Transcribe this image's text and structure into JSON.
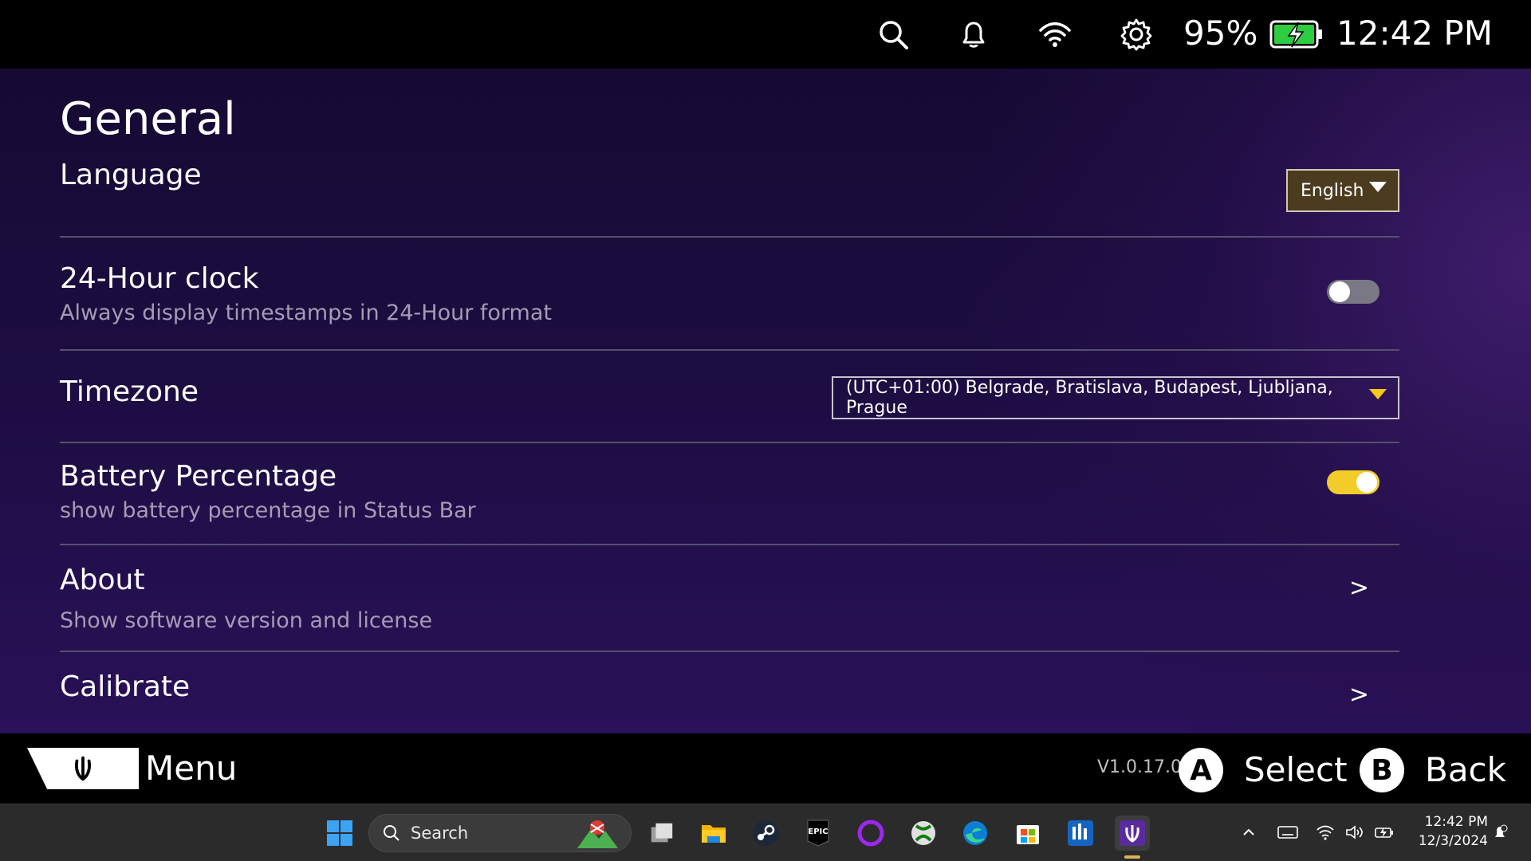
{
  "status_bar": {
    "icons": [
      "search-icon",
      "bell-icon",
      "wifi-icon",
      "gear-icon"
    ],
    "battery_percent": "95%",
    "battery_icon": "battery-charging-icon",
    "time": "12:42 PM"
  },
  "page": {
    "title": "General"
  },
  "settings": {
    "language": {
      "title": "Language",
      "value": "English"
    },
    "clock24": {
      "title": "24-Hour clock",
      "subtitle": "Always display timestamps in 24-Hour format",
      "enabled": false
    },
    "timezone": {
      "title": "Timezone",
      "value": "(UTC+01:00) Belgrade, Bratislava, Budapest, Ljubljana, Prague"
    },
    "battery": {
      "title": "Battery Percentage",
      "subtitle": "show battery percentage in Status Bar",
      "enabled": true
    },
    "about": {
      "title": "About",
      "subtitle": "Show software version and license",
      "chevron": ">"
    },
    "calibrate": {
      "title": "Calibrate",
      "chevron": ">"
    }
  },
  "control_bar": {
    "menu_label": "Menu",
    "version": "V1.0.17.0",
    "a_button": "A",
    "a_label": "Select",
    "b_button": "B",
    "b_label": "Back"
  },
  "taskbar": {
    "search_label": "Search",
    "epic_label": "EPIC",
    "apps": [
      "windows-start-icon",
      "task-view-icon",
      "file-explorer-icon",
      "steam-icon",
      "epic-games-icon",
      "circle-app-icon",
      "xbox-icon",
      "edge-icon",
      "store-icon",
      "app-icon",
      "legion-space-icon"
    ],
    "tray_time": "12:42 PM",
    "tray_date": "12/3/2024"
  },
  "colors": {
    "accent_yellow": "#f2cd2a",
    "bg_purple": "#1d0d43",
    "toggle_off": "#7b7885"
  }
}
